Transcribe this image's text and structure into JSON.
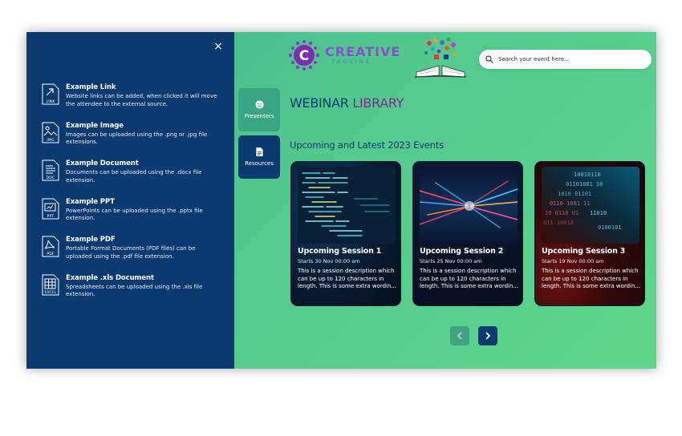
{
  "panel": {
    "close_label": "×",
    "items": [
      {
        "tag": "LINK",
        "icon": "link-icon",
        "title": "Example Link",
        "desc": "Website links can be added, when clicked it will move the attendee to the external source."
      },
      {
        "tag": "IMG",
        "icon": "image-icon",
        "title": "Example Image",
        "desc": "Images can be uploaded using the .png or .jpg file extensions."
      },
      {
        "tag": "DOC",
        "icon": "document-icon",
        "title": "Example Document",
        "desc": "Documents can be uploaded using the .docx file extension."
      },
      {
        "tag": "PPT",
        "icon": "ppt-icon",
        "title": "Example PPT",
        "desc": "PowerPoints can be uploaded using the .pptx file extension."
      },
      {
        "tag": "PDF",
        "icon": "pdf-icon",
        "title": "Example PDF",
        "desc": "Portable Format Documents (PDF files) can be uploaded using the .pdf file extension."
      },
      {
        "tag": "EXCEL",
        "icon": "spreadsheet-icon",
        "title": "Example .xls Document",
        "desc": "Spreadsheets can be uploaded using the .xls file extension."
      }
    ]
  },
  "nav": {
    "presenters": "Presenters",
    "resources": "Resources"
  },
  "logo": {
    "letter": "C",
    "main": "CREATIVE",
    "sub": "TAGLINE"
  },
  "search": {
    "placeholder": "Search your event here..."
  },
  "page": {
    "title_part1": "WEBINAR",
    "title_part2": "LIBRARY",
    "section_title": "Upcoming and Latest 2023 Events"
  },
  "sessions": [
    {
      "title": "Upcoming Session 1",
      "date": "Starts 30 Nov 00:00 am",
      "desc": "This is a session description which can be up to 120 characters in length. This is some extra wordin..."
    },
    {
      "title": "Upcoming Session 2",
      "date": "Starts 25 Nov 00:00 am",
      "desc": "This is a session description which can be up to 120 characters in length. This is some extra wordin..."
    },
    {
      "title": "Upcoming Session 3",
      "date": "Starts 19 Nov 00:00 am",
      "desc": "This is a session description which can be up to 120 characters in length. This is some extra wordin..."
    }
  ],
  "colors": {
    "navy": "#0b3a70",
    "accent_purple": "#7a2e8a",
    "bg_green": "#53c98e"
  }
}
